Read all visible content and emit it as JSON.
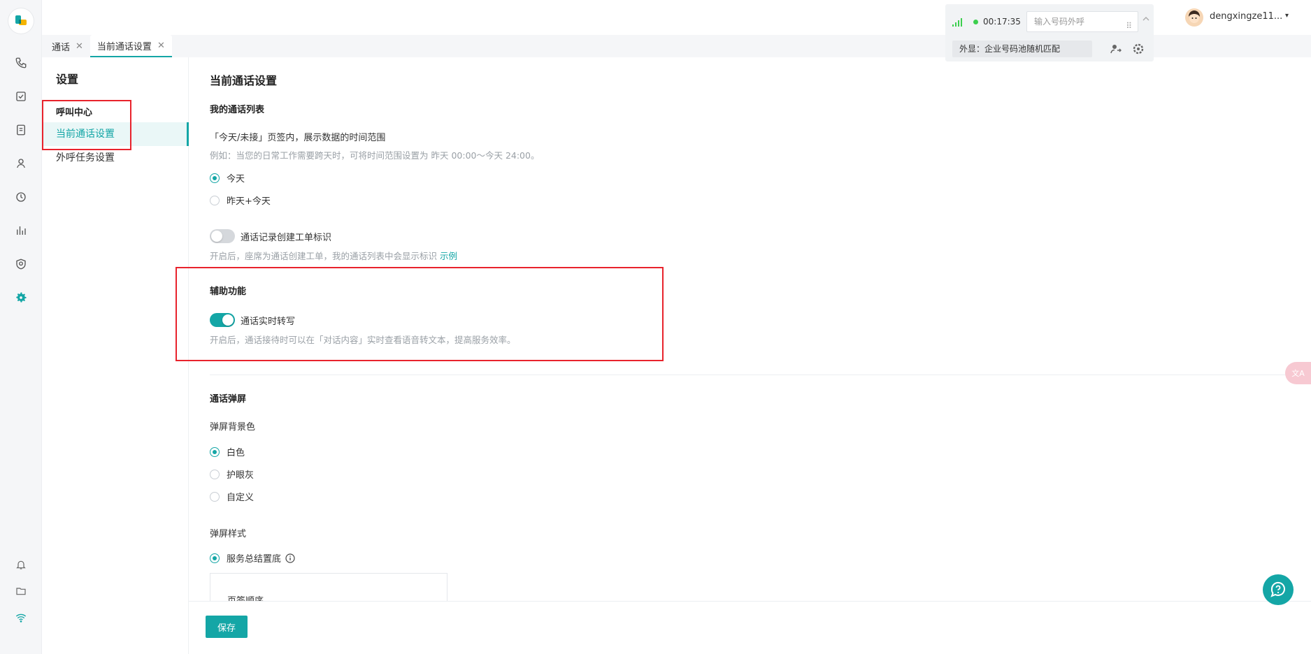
{
  "tabs": [
    {
      "label": "通话",
      "close": "✕"
    },
    {
      "label": "当前通话设置",
      "close": "✕"
    }
  ],
  "sidebar": {
    "title": "设置",
    "group": "呼叫中心",
    "items": [
      {
        "label": "当前通话设置"
      },
      {
        "label": "外呼任务设置"
      }
    ]
  },
  "main": {
    "title": "当前通话设置",
    "call_list": {
      "heading": "我的通话列表",
      "desc": "「今天/未接」页签内，展示数据的时间范围",
      "hint": "例如：当您的日常工作需要跨天时，可将时间范围设置为 昨天 00:00～今天 24:00。",
      "options": [
        "今天",
        "昨天+今天"
      ],
      "selected": "今天"
    },
    "ticket_switch": {
      "label": "通话记录创建工单标识",
      "on": false,
      "hint": "开启后，座席为通话创建工单，我的通话列表中会显示标识",
      "link": "示例"
    },
    "assist": {
      "heading": "辅助功能",
      "switch_label": "通话实时转写",
      "on": true,
      "hint": "开启后，通话接待时可以在「对话内容」实时查看语音转文本，提高服务效率。"
    },
    "popup": {
      "heading": "通话弹屏",
      "bg_label": "弹屏背景色",
      "bg_options": [
        "白色",
        "护眼灰",
        "自定义"
      ],
      "bg_selected": "白色",
      "style_label": "弹屏样式",
      "style_option": "服务总结置底",
      "card_label": "页签顺序"
    }
  },
  "footer": {
    "save_label": "保存"
  },
  "widget": {
    "time": "00:17:35",
    "input_placeholder": "输入号码外呼",
    "keypad": "⠿",
    "caller_display": "外显：企业号码池随机匹配"
  },
  "user": {
    "name": "dengxingze11...",
    "caret": "▾"
  },
  "floats": {
    "translate": "文A"
  },
  "colors": {
    "accent": "#14a6a6",
    "highlight": "#e8232c",
    "status_green": "#3ccf4e"
  }
}
